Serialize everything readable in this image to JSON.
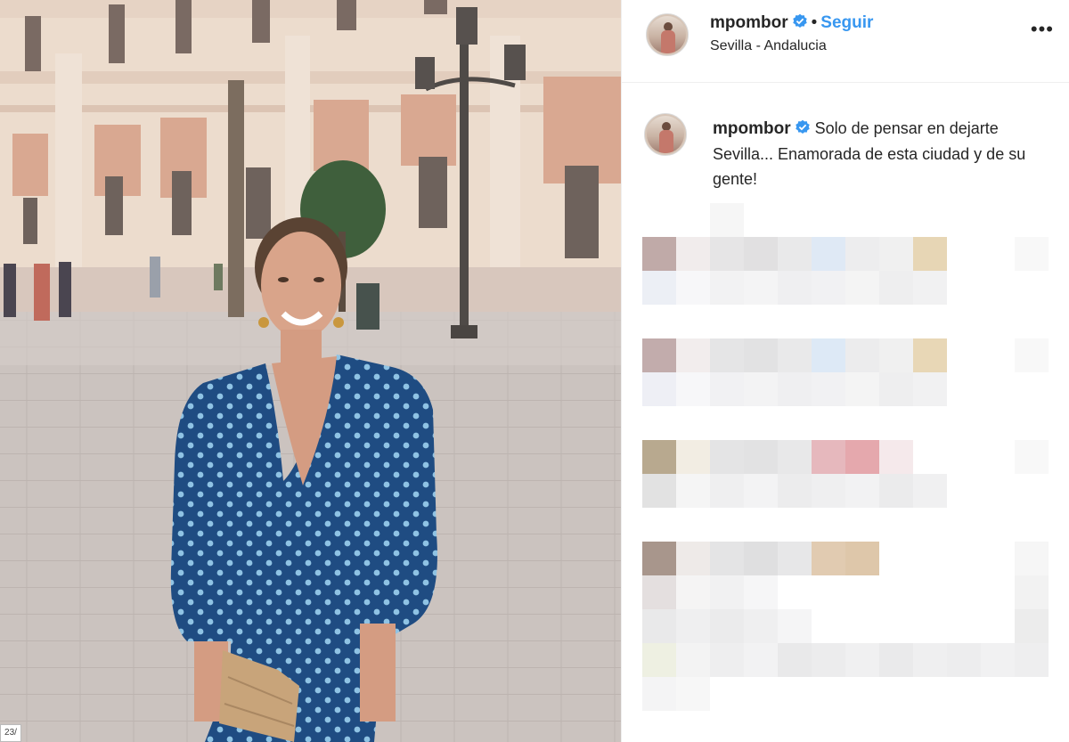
{
  "post": {
    "username": "mpombor",
    "follow_label": "Seguir",
    "separator": "•",
    "location": "Sevilla - Andalucia",
    "more_icon": "more-options-icon",
    "verified_icon": "verified-badge-icon"
  },
  "caption": {
    "username": "mpombor",
    "text": "Solo de pensar en dejarte Sevilla... Enamorada de esta ciudad y de su gente!"
  },
  "photo": {
    "corner_tag": "23/"
  },
  "colors": {
    "accent": "#3897f0",
    "verified": "#3897f0",
    "text": "#262626",
    "dress": "#1f4f86",
    "dots": "#8cc1e3"
  }
}
